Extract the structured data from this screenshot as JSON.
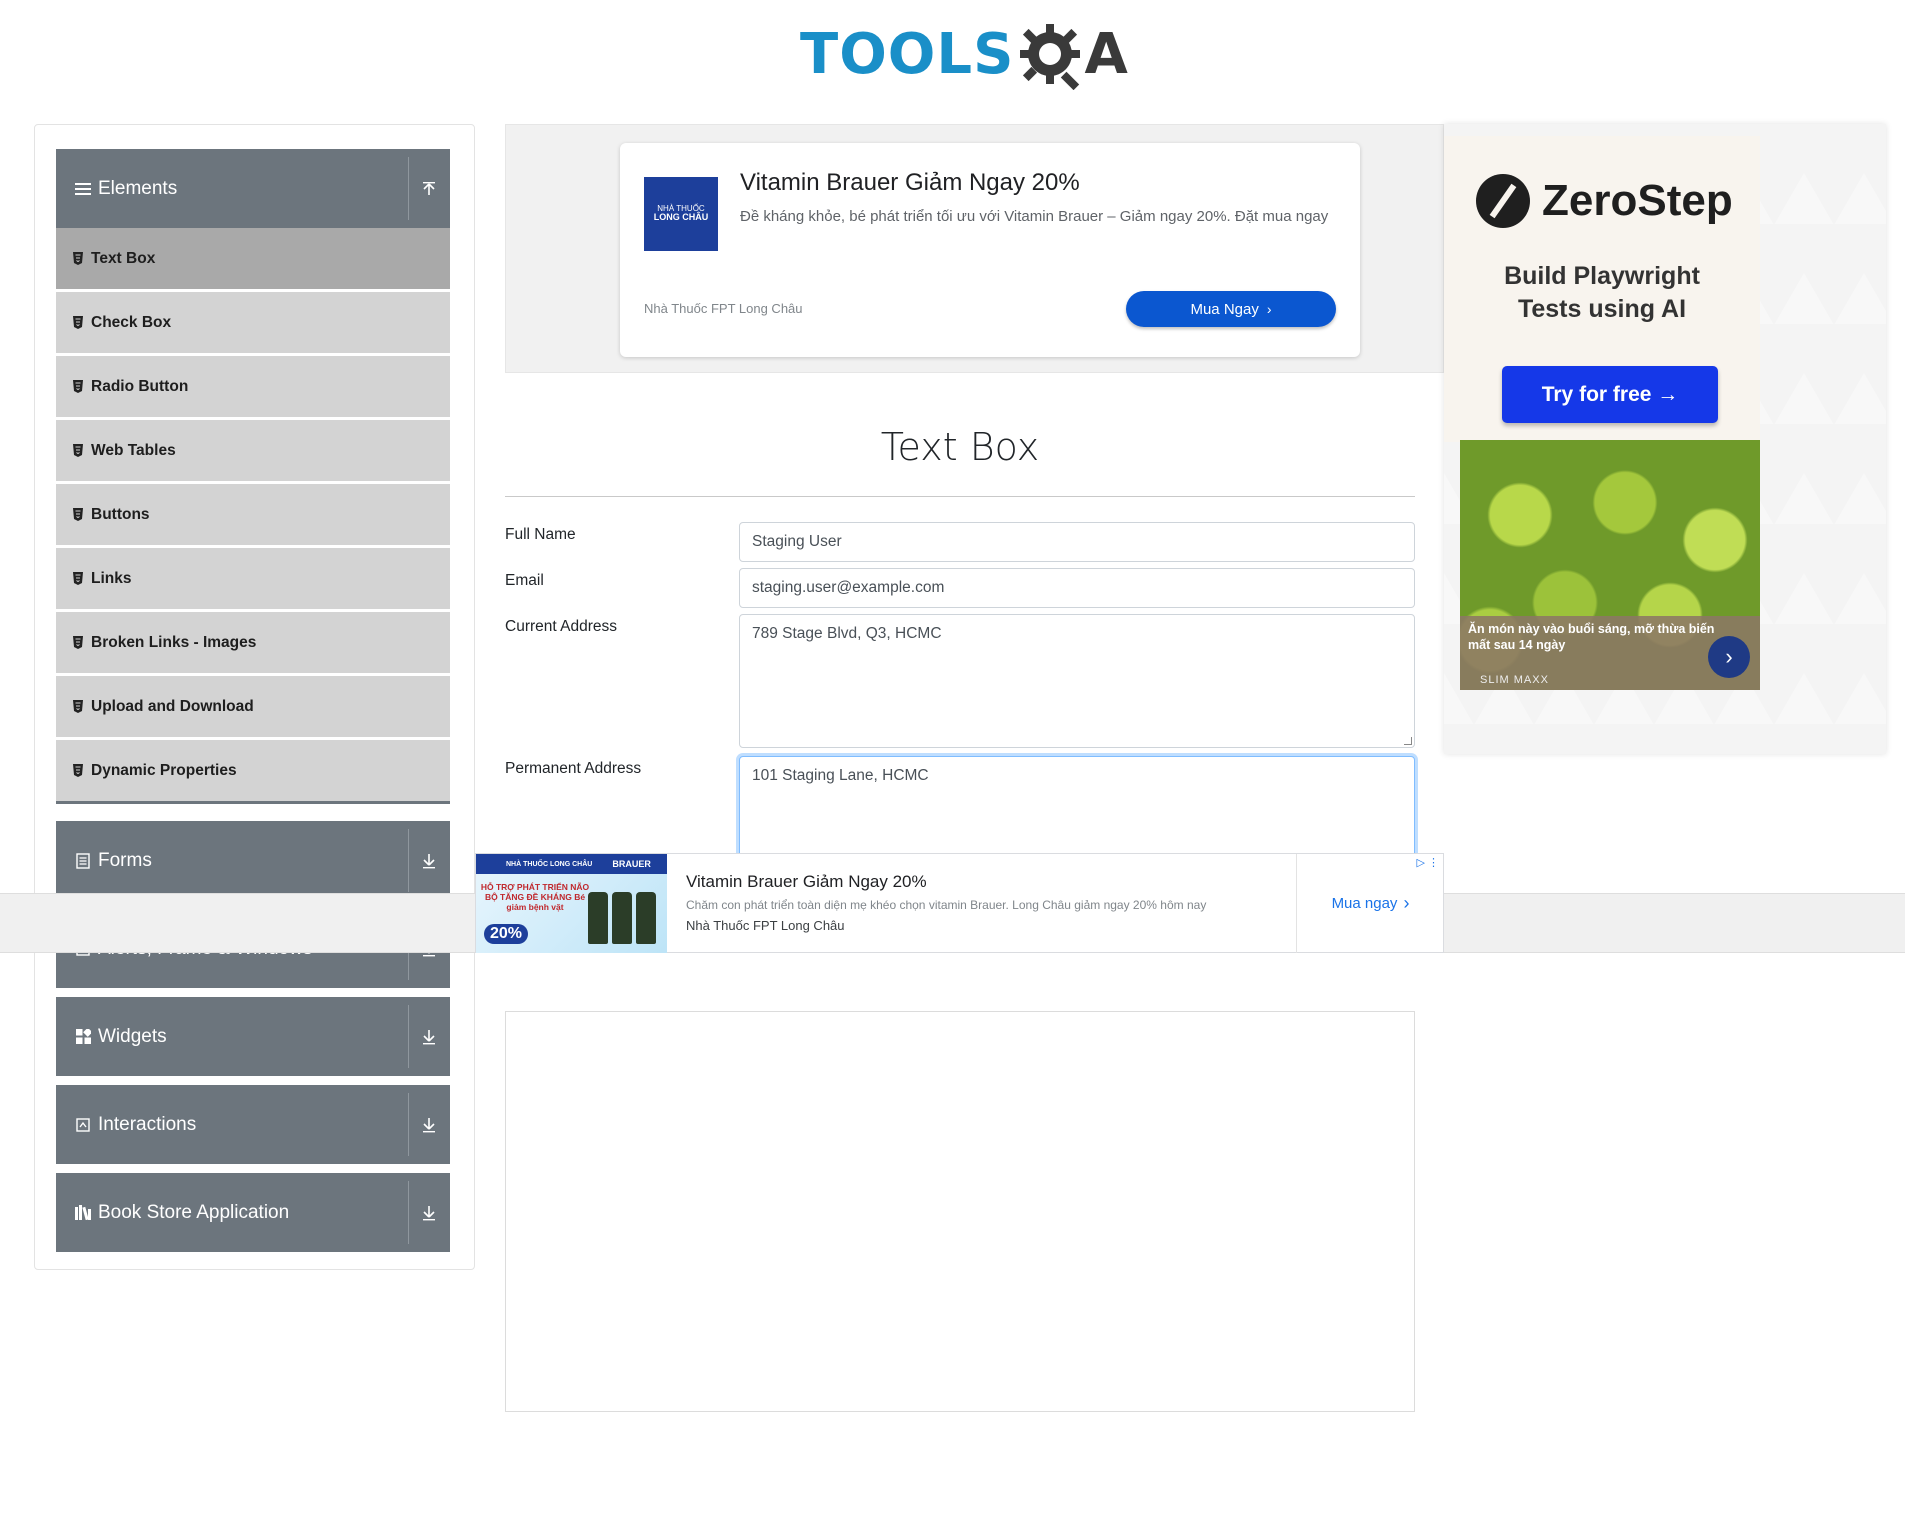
{
  "header": {
    "logo_text": "TOOLS",
    "logo_suffix": "A"
  },
  "sidebar": {
    "groups": [
      {
        "title": "Elements",
        "items": [
          "Text Box",
          "Check Box",
          "Radio Button",
          "Web Tables",
          "Buttons",
          "Links",
          "Broken Links - Images",
          "Upload and Download",
          "Dynamic Properties"
        ]
      },
      {
        "title": "Forms"
      },
      {
        "title": "Alerts, Frame & Windows"
      },
      {
        "title": "Widgets"
      },
      {
        "title": "Interactions"
      },
      {
        "title": "Book Store Application"
      }
    ]
  },
  "top_ad": {
    "logo_line1": "NHÀ THUỐC",
    "logo_line2": "LONG CHÂU",
    "title": "Vitamin Brauer Giảm Ngay 20%",
    "description": "Đề kháng khỏe, bé phát triển tối ưu với Vitamin Brauer – Giảm ngay 20%. Đặt mua ngay",
    "source": "Nhà Thuốc FPT Long Châu",
    "button": "Mua Ngay"
  },
  "right_ad": {
    "brand": "ZeroStep",
    "subtitle_line1": "Build Playwright",
    "subtitle_line2": "Tests using AI",
    "button": "Try for free →",
    "caption": "Ăn món này vào buổi sáng, mỡ thừa biến mất sau 14 ngày",
    "caption_brand": "SLIM MAXX"
  },
  "main": {
    "title": "Text Box",
    "labels": {
      "full_name": "Full Name",
      "email": "Email",
      "current_address": "Current Address",
      "permanent_address": "Permanent Address"
    },
    "values": {
      "full_name": "Staging User",
      "email": "staging.user@example.com",
      "current_address": "789 Stage Blvd, Q3, HCMC",
      "permanent_address": "101 Staging Lane, HCMC"
    }
  },
  "bottom_ad": {
    "img_header_left": "NHÀ THUỐC LONG CHÂU",
    "img_header_right": "BRAUER",
    "img_text": "HỖ TRỢ PHÁT TRIỂN NÃO BỘ TĂNG ĐỀ KHÁNG Bé giảm bệnh vặt",
    "img_badge": "20%",
    "title": "Vitamin Brauer Giảm Ngay 20%",
    "description": "Chăm con phát triển toàn diện mẹ khéo chọn vitamin Brauer. Long Châu giảm ngay 20% hôm nay",
    "source": "Nhà Thuốc FPT Long Châu",
    "cta": "Mua ngay"
  }
}
